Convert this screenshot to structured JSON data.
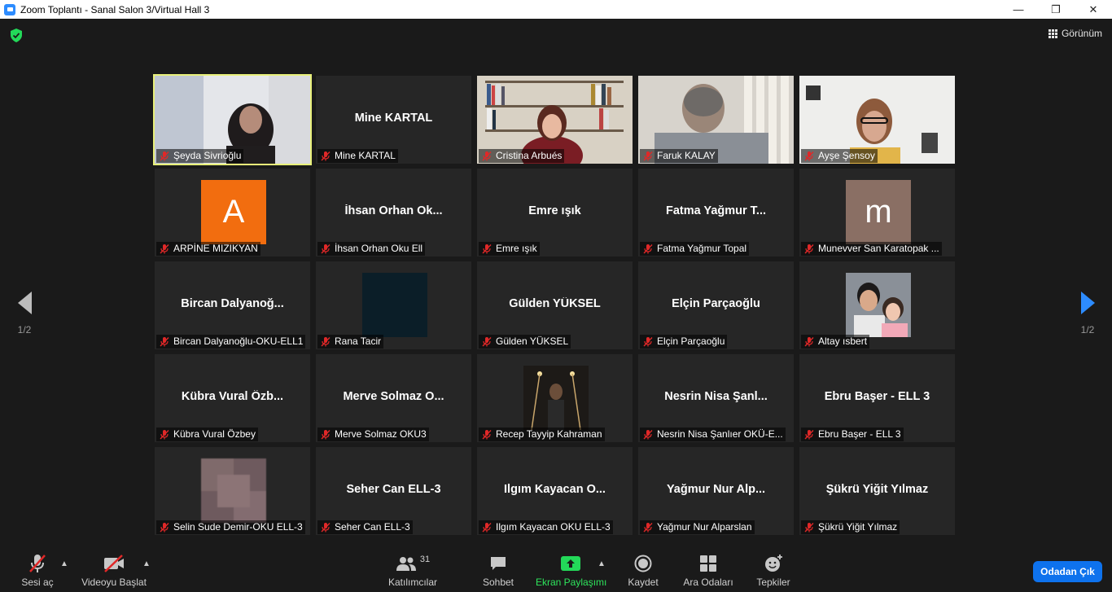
{
  "window": {
    "title": "Zoom Toplantı - Sanal Salon 3/Virtual Hall 3",
    "minimize": "—",
    "maximize": "❐",
    "close": "✕"
  },
  "header": {
    "view_label": "Görünüm"
  },
  "pagination": {
    "left": "1/2",
    "right": "1/2"
  },
  "participants": [
    {
      "name": "Şeyda Sivrioğlu",
      "big": "",
      "kind": "video",
      "active": true
    },
    {
      "name": "Mine KARTAL",
      "big": "Mine KARTAL",
      "kind": "name"
    },
    {
      "name": "Cristina Arbués",
      "big": "",
      "kind": "video"
    },
    {
      "name": "Faruk KALAY",
      "big": "",
      "kind": "video"
    },
    {
      "name": "Ayşe Şensoy",
      "big": "",
      "kind": "video"
    },
    {
      "name": "ARPİNE MIZIKYAN",
      "big": "A",
      "kind": "avatar",
      "color": "#f26d0f"
    },
    {
      "name": "İhsan Orhan Oku Ell",
      "big": "İhsan Orhan Ok...",
      "kind": "name"
    },
    {
      "name": "Emre ışık",
      "big": "Emre ışık",
      "kind": "name"
    },
    {
      "name": "Fatma Yağmur Topal",
      "big": "Fatma Yağmur T...",
      "kind": "name"
    },
    {
      "name": "Munevver San Karatopak ...",
      "big": "m",
      "kind": "avatar",
      "color": "#8a6f64"
    },
    {
      "name": "Bircan Dalyanoğlu-OKU-ELL1",
      "big": "Bircan  Dalyanoğ...",
      "kind": "name"
    },
    {
      "name": "Rana Tacir",
      "big": "",
      "kind": "photo",
      "color": "#0b1e28"
    },
    {
      "name": "Gülden YÜKSEL",
      "big": "Gülden YÜKSEL",
      "kind": "name"
    },
    {
      "name": "Elçin Parçaoğlu",
      "big": "Elçin Parçaoğlu",
      "kind": "name"
    },
    {
      "name": "Altay ısbert",
      "big": "",
      "kind": "photo",
      "color": "#6c7480"
    },
    {
      "name": "Kübra Vural Özbey",
      "big": "Kübra  Vural  Özb...",
      "kind": "name"
    },
    {
      "name": "Merve Solmaz OKU3",
      "big": "Merve  Solmaz  O...",
      "kind": "name"
    },
    {
      "name": "Recep Tayyip Kahraman",
      "big": "",
      "kind": "photo",
      "color": "#2a221a"
    },
    {
      "name": "Nesrin Nisa Şanlıer OKÜ-E...",
      "big": "Nesrin  Nisa  Şanl...",
      "kind": "name"
    },
    {
      "name": "Ebru Başer - ELL 3",
      "big": "Ebru Başer - ELL 3",
      "kind": "name"
    },
    {
      "name": "Selin Sude Demir-OKU ELL-3",
      "big": "",
      "kind": "photo",
      "color": "#7a6668"
    },
    {
      "name": "Seher Can ELL-3",
      "big": "Seher Can ELL-3",
      "kind": "name"
    },
    {
      "name": "Ilgım Kayacan OKU ELL-3",
      "big": "Ilgım  Kayacan  O...",
      "kind": "name"
    },
    {
      "name": "Yağmur Nur Alparslan",
      "big": "Yağmur  Nur  Alp...",
      "kind": "name"
    },
    {
      "name": "Şükrü Yiğit Yılmaz",
      "big": "Şükrü Yiğit Yılmaz",
      "kind": "name"
    }
  ],
  "toolbar": {
    "audio": "Sesi aç",
    "video": "Videoyu Başlat",
    "participants": "Katılımcılar",
    "participants_count": "31",
    "chat": "Sohbet",
    "share": "Ekran Paylaşımı",
    "record": "Kaydet",
    "breakout": "Ara Odaları",
    "reactions": "Tepkiler",
    "leave": "Odadan Çık"
  },
  "colors": {
    "accent": "#2d8cff",
    "share_green": "#2ee55c",
    "leave_blue": "#0e72ed",
    "mute_red": "#e02828",
    "active_border": "#e8f07a"
  }
}
